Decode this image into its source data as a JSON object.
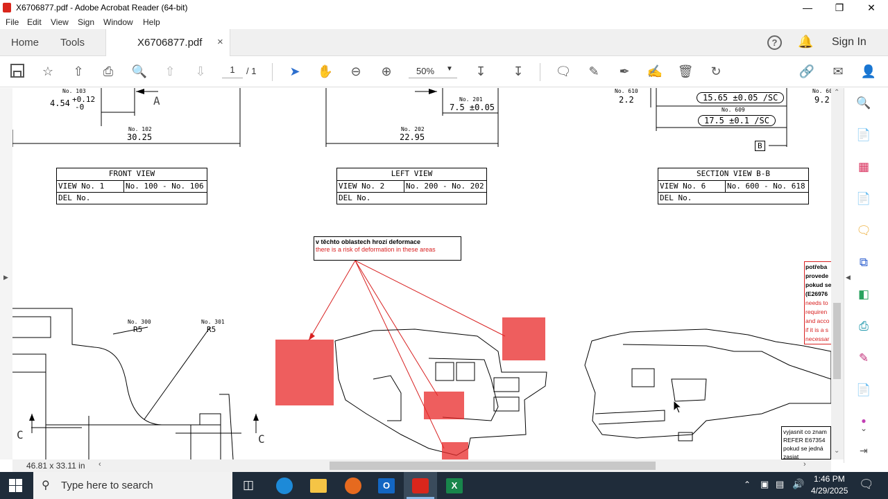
{
  "window": {
    "title": "X6706877.pdf - Adobe Acrobat Reader (64-bit)"
  },
  "menu": [
    "File",
    "Edit",
    "View",
    "Sign",
    "Window",
    "Help"
  ],
  "tabs": {
    "home": "Home",
    "tools": "Tools",
    "doc": "X6706877.pdf",
    "signin": "Sign In"
  },
  "toolbar": {
    "page_current": "1",
    "page_total": "/ 1",
    "zoom": "50%"
  },
  "drawing": {
    "front": {
      "dim103_no": "No. 103",
      "dim103_val": "4.54",
      "dim103_tol_up": "+0.12",
      "dim103_tol_dn": "-0",
      "A": "A",
      "dim102_no": "No. 102",
      "dim102_val": "30.25"
    },
    "left": {
      "dim201_no": "No. 201",
      "dim201_val": "7.5 ±0.05",
      "dim202_no": "No. 202",
      "dim202_val": "22.95"
    },
    "section": {
      "dim610_no": "No. 610",
      "dim610_val": "2.2",
      "dim608_val": "15.65 ±0.05 /SC",
      "dim609_no": "No. 609",
      "dim609_val": "17.5 ±0.1 /SC",
      "B": "B",
      "dim60x_no": "No. 60",
      "dim60x_val": "9.2"
    },
    "tables": [
      {
        "title": "FRONT VIEW",
        "view": "VIEW No. 1",
        "range": "No. 100 - No. 106",
        "del": "DEL No."
      },
      {
        "title": "LEFT VIEW",
        "view": "VIEW No. 2",
        "range": "No. 200 - No. 202",
        "del": "DEL No."
      },
      {
        "title": "SECTION VIEW B-B",
        "view": "VIEW No. 6",
        "range": "No. 600 - No. 618",
        "del": "DEL No."
      }
    ],
    "note": {
      "cz": "v těchto oblastech hrozí deformace",
      "en": "there is a risk of deformation in these areas"
    },
    "right_note": [
      "potřeba",
      "provede",
      "pokud se",
      "(E26976",
      "needs to",
      "requiren",
      "and acco",
      "if it is a s",
      "necessar"
    ],
    "r300_no": "No. 300",
    "r300": "R5",
    "r301_no": "No. 301",
    "r301": "R5",
    "C1": "C",
    "C2": "C",
    "refer_note": [
      "vyjasnit co znam",
      "REFER E67354",
      "pokud se jedná",
      "zasiat"
    ]
  },
  "status": {
    "size": "46.81 x 33.11 in"
  },
  "taskbar": {
    "search": "Type here to search",
    "time": "1:46 PM",
    "date": "4/29/2025"
  },
  "colors": {
    "red_highlight": "#e82828",
    "accent": "#2d6fce",
    "taskbar": "#1f2c3a"
  }
}
